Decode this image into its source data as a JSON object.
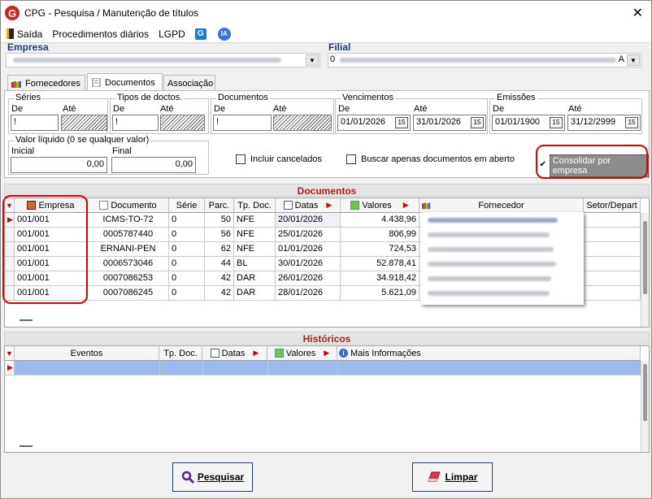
{
  "window": {
    "title": "CPG - Pesquisa / Manutenção de títulos"
  },
  "menu": [
    {
      "label": "Saída"
    },
    {
      "label": "Procedimentos diários"
    },
    {
      "label": "LGPD"
    }
  ],
  "menu_icons": {
    "g": "G",
    "ia": "IA"
  },
  "header": {
    "empresa_label": "Empresa",
    "filial_label": "Filial",
    "filial_prefix": "0",
    "filial_suffix": "A"
  },
  "tabs": [
    {
      "label": "Fornecedores"
    },
    {
      "label": "Documentos"
    },
    {
      "label": "Associação"
    }
  ],
  "filters": {
    "series": {
      "title": "Séries",
      "de": "De",
      "ate": "Até",
      "de_value": "!",
      "ate_value": ""
    },
    "tipos": {
      "title": "Tipos de doctos.",
      "de": "De",
      "ate": "Até",
      "de_value": "!",
      "ate_value": ""
    },
    "documentos": {
      "title": "Documentos",
      "de": "De",
      "ate": "Até",
      "de_value": "!",
      "ate_value": ""
    },
    "vencimentos": {
      "title": "Vencimentos",
      "de": "De",
      "ate": "Até",
      "de_value": "01/01/2026",
      "ate_value": "31/01/2026",
      "cal": "15"
    },
    "emissoes": {
      "title": "Emissões",
      "de": "De",
      "ate": "Até",
      "de_value": "01/01/1900",
      "ate_value": "31/12/2999",
      "cal": "15"
    },
    "valor": {
      "title": "Valor líquido (0 se qualquer valor)",
      "inicial": "Inicial",
      "final": "Final",
      "inicial_value": "0,00",
      "final_value": "0,00"
    }
  },
  "checkboxes": {
    "incluir_cancelados": {
      "label": "Incluir cancelados",
      "checked": false
    },
    "buscar_aberto": {
      "label": "Buscar apenas documentos em aberto",
      "checked": false
    },
    "consolidar": {
      "label": "Consolidar por empresa",
      "checked": true
    }
  },
  "documentos_section": {
    "title": "Documentos",
    "columns": [
      "Empresa",
      "Documento",
      "Série",
      "Parc.",
      "Tp. Doc.",
      "Datas",
      "Valores",
      "Fornecedor",
      "Setor/Depart"
    ],
    "rows": [
      {
        "empresa": "001/001",
        "documento": "ICMS-TO-72",
        "serie": "0",
        "parc": "50",
        "tp_doc": "NFE",
        "data": "20/01/2026",
        "valor": "4.438,96"
      },
      {
        "empresa": "001/001",
        "documento": "0005787440",
        "serie": "0",
        "parc": "56",
        "tp_doc": "NFE",
        "data": "25/01/2026",
        "valor": "806,99"
      },
      {
        "empresa": "001/001",
        "documento": "ERNANI-PEN",
        "serie": "0",
        "parc": "62",
        "tp_doc": "NFE",
        "data": "01/01/2026",
        "valor": "724,53"
      },
      {
        "empresa": "001/001",
        "documento": "0006573046",
        "serie": "0",
        "parc": "44",
        "tp_doc": "BL",
        "data": "30/01/2026",
        "valor": "52.878,41"
      },
      {
        "empresa": "001/001",
        "documento": "0007086253",
        "serie": "0",
        "parc": "42",
        "tp_doc": "DAR",
        "data": "26/01/2026",
        "valor": "34.918,42"
      },
      {
        "empresa": "001/001",
        "documento": "0007086245",
        "serie": "0",
        "parc": "42",
        "tp_doc": "DAR",
        "data": "28/01/2026",
        "valor": "5.621,09"
      }
    ]
  },
  "historicos_section": {
    "title": "Históricos",
    "columns": [
      "Eventos",
      "Tp. Doc.",
      "Datas",
      "Valores",
      "Mais Informações"
    ]
  },
  "buttons": {
    "pesquisar": {
      "label": "Pesquisar"
    },
    "limpar": {
      "label": "Limpar"
    }
  },
  "colors": {
    "accent": "#1f3a7a",
    "section_title": "#b01c1c",
    "selection": "#9cb9ec",
    "highlight_frame": "#e00000"
  }
}
